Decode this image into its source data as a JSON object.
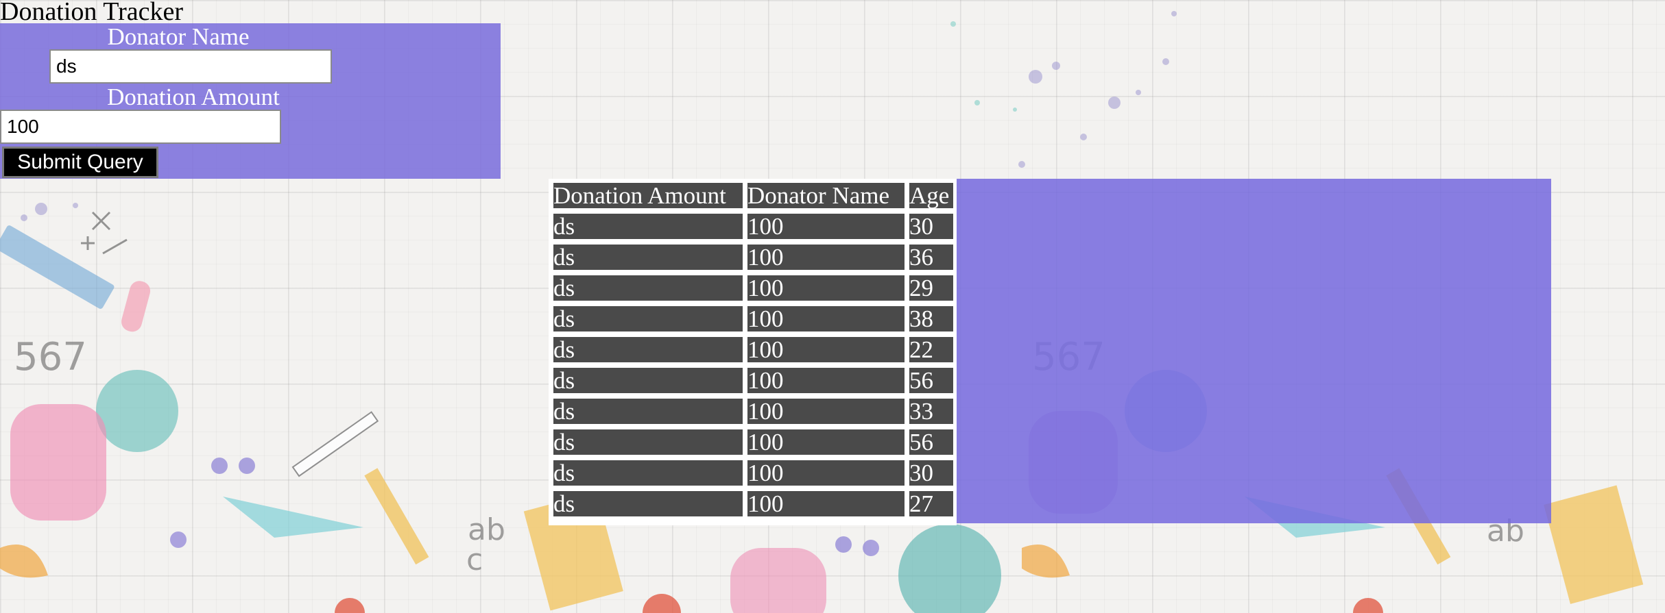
{
  "app": {
    "title": "Donation Tracker"
  },
  "form": {
    "name_label": "Donator Name",
    "name_value": "ds",
    "amount_label": "Donation Amount",
    "amount_value": "100",
    "submit_label": "Submit Query"
  },
  "table": {
    "headers": [
      "Donation Amount",
      "Donator Name",
      "Age"
    ],
    "rows": [
      [
        "ds",
        "100",
        "30"
      ],
      [
        "ds",
        "100",
        "36"
      ],
      [
        "ds",
        "100",
        "29"
      ],
      [
        "ds",
        "100",
        "38"
      ],
      [
        "ds",
        "100",
        "22"
      ],
      [
        "ds",
        "100",
        "56"
      ],
      [
        "ds",
        "100",
        "33"
      ],
      [
        "ds",
        "100",
        "56"
      ],
      [
        "ds",
        "100",
        "30"
      ],
      [
        "ds",
        "100",
        "27"
      ]
    ]
  },
  "colors": {
    "panel": "#7c70dc",
    "cell": "#4a4a4a"
  }
}
